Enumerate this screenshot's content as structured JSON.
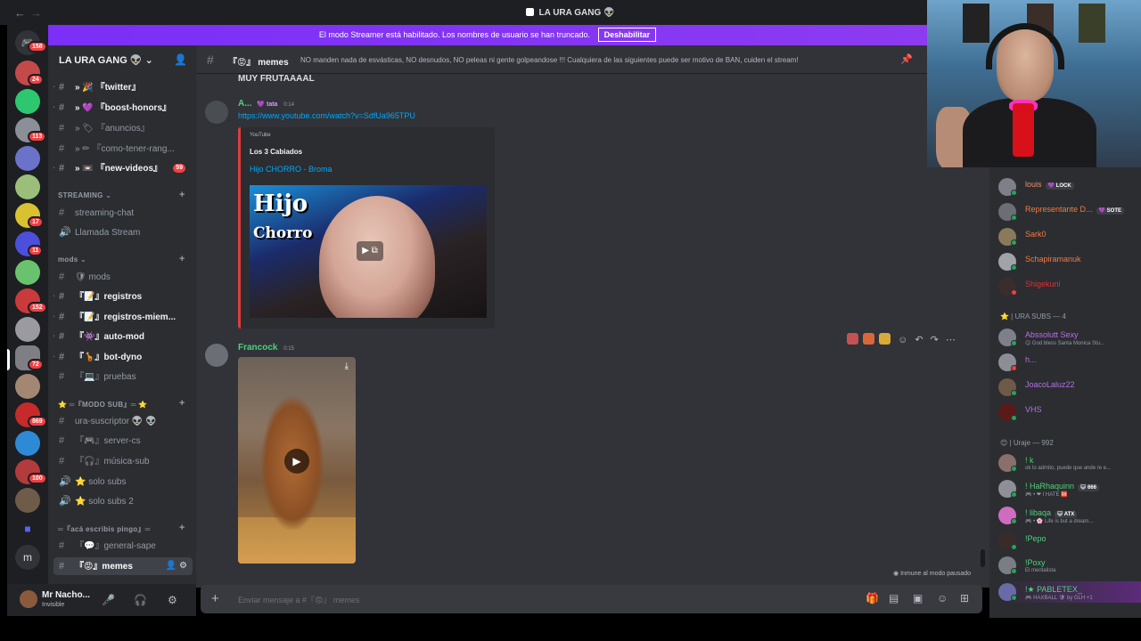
{
  "window": {
    "title": "LA URA GANG 👽"
  },
  "banner": {
    "text": "El modo Streamer está habilitado. Los nombres de usuario se han truncado.",
    "button": "Deshabilitar"
  },
  "rail": {
    "badges": [
      "158",
      "24",
      "113",
      "17",
      "11",
      "152",
      "72",
      "869",
      "100"
    ],
    "servers_top": [
      "40",
      "79",
      "112",
      "144",
      "176",
      "208",
      "240",
      "272",
      "302",
      "336",
      "368",
      "400",
      "432",
      "464",
      "496",
      "528",
      "560"
    ]
  },
  "guild": {
    "name": "LA URA GANG 👽"
  },
  "channels": [
    {
      "name": "» 🎉 『twitter』"
    },
    {
      "name": "» 💜 『boost-honors』"
    },
    {
      "name": "» 🏷 『anuncios』"
    },
    {
      "name": "» ✏ 『como-tener-rang..."
    },
    {
      "name": "» 📼 『new-videos』",
      "badge": "59"
    }
  ],
  "categories": {
    "streaming": "STREAMING ⌄",
    "mods": "mods ⌄",
    "modo_sub": "⭐ ═『MODO SUB』═ ⭐",
    "aca": "═『acá escribis pingo』═"
  },
  "streaming_channels": [
    "streaming-chat",
    "Llamada Stream"
  ],
  "mod_channels": [
    "🛡 mods",
    "『📝』registros",
    "『📝』registros-miem...",
    "『👾』auto-mod",
    "『🦒』bot-dyno",
    "『💻』pruebas"
  ],
  "sub_channels": [
    "ura-suscriptor 👽 👽",
    "『🎮』server-cs",
    "『🎧』música-sub",
    "⭐ solo subs",
    "⭐ solo subs 2"
  ],
  "general_channels": [
    "『💬』general-sape",
    "『😡』memes"
  ],
  "user": {
    "name": "Mr Nacho...",
    "status": "Invisible"
  },
  "chat_header": {
    "channel": "『😡』 memes",
    "topic": "NO manden nada de esvásticas, NO desnudos, NO peleas ni gente golpeandose !!! Cualquiera de las siguientes puede ser motivo de BAN, cuiden el stream!"
  },
  "messages": {
    "top_text": "MUY FRUTAAAAL",
    "m1": {
      "author": "A...",
      "tag": "💜 tata",
      "time": "0:14",
      "link": "https://www.youtube.com/watch?v=SdfUa965TPU",
      "embed_provider": "YouTube",
      "embed_title": "Los 3 Cabiados",
      "embed_sub": "Hijo CHORRO - Broma",
      "thumb_line1": "Hijo",
      "thumb_line2": "Chorro"
    },
    "m2": {
      "author": "Francock",
      "time": "0:15"
    }
  },
  "paused_note": "Inmune al modo pausado",
  "composer": {
    "placeholder": "Enviar mensaje a #『😡』 memes"
  },
  "members": {
    "top": [
      {
        "name": "louis",
        "tag": "💜 LOCK",
        "color": "#ed8f6b"
      },
      {
        "name": "Representante D...",
        "tag": "💜 SOTE",
        "color": "#f47b3f"
      },
      {
        "name": "Sark0",
        "color": "#f47b3f"
      },
      {
        "name": "Schapiramanuk",
        "color": "#f47b3f"
      },
      {
        "name": "Shigekuni",
        "color": "#e22f2f"
      }
    ],
    "subs_header": "⭐ | URA SUBS — 4",
    "subs": [
      {
        "name": "Abssolutt Sexy",
        "sub": "😊 God bless Santa Monica Stu...",
        "color": "#b86fe8"
      },
      {
        "name": "h...",
        "color": "#b86fe8"
      },
      {
        "name": "JoacoLaluz22",
        "color": "#b86fe8"
      },
      {
        "name": "VHS",
        "color": "#b86fe8"
      }
    ],
    "uraje_header": "😊 | Uraje — 992",
    "uraje": [
      {
        "name": "! k",
        "sub": "ok lo admito, puede que ande re e...",
        "color": "#4fd17b"
      },
      {
        "name": "! HaRhaquinn",
        "tag": "😺 666",
        "sub": "🎮 • ❤ I HATE 🆘",
        "color": "#4fd17b"
      },
      {
        "name": "! libaqa",
        "tag": "😺 ATX",
        "sub": "🎮 • 🌸 Life is but a dream...",
        "color": "#4fd17b"
      },
      {
        "name": "!Pepo",
        "color": "#4fd17b"
      },
      {
        "name": "!Poxy",
        "sub": "El mentalista",
        "color": "#4fd17b"
      },
      {
        "name": "!★ PABLETEX_",
        "sub": "🎮 HAXBALL 🛡 by GLH +1",
        "color": "#4fd17b"
      }
    ]
  }
}
